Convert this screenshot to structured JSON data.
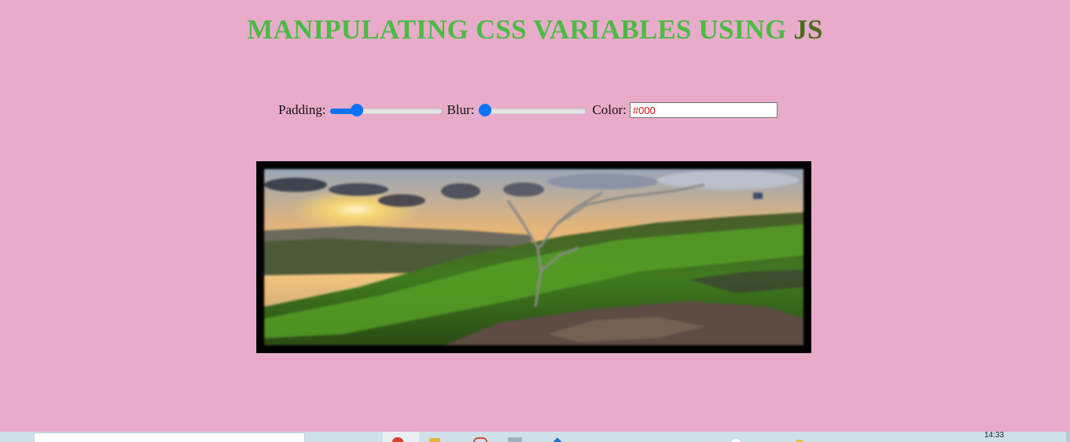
{
  "header": {
    "title_main": "MANIPULATING CSS VARIABLES USING",
    "title_highlight": "JS"
  },
  "controls": {
    "padding_label": "Padding:",
    "padding_value": 0.2,
    "blur_label": "Blur:",
    "blur_value": 0.0,
    "color_label": "Color:",
    "color_value": "#000"
  },
  "image": {
    "description_icon": "landscape-photo",
    "frame_color": "#000000"
  },
  "taskbar": {
    "clock": "14:33"
  },
  "colors": {
    "background": "#e8acca",
    "title": "#4cbb44",
    "title_highlight": "#4e6a1e",
    "slider_accent": "#0b73f5"
  }
}
